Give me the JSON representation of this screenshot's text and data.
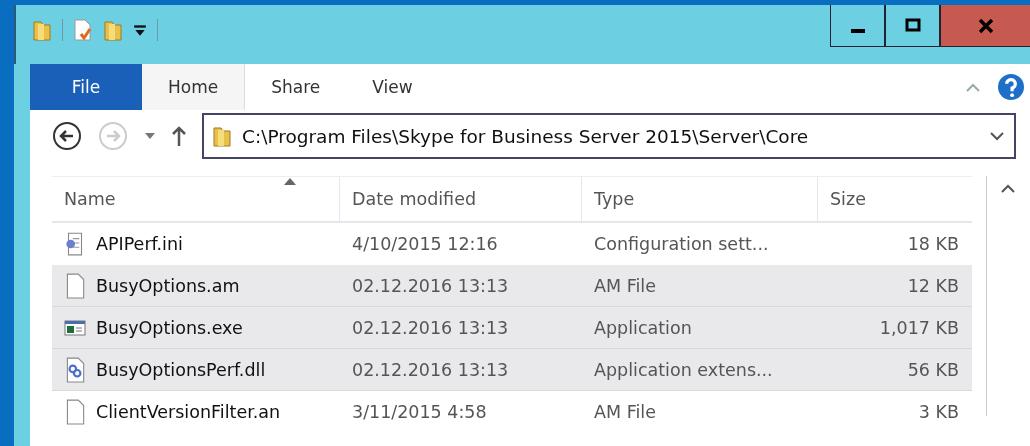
{
  "ribbon_tabs": [
    {
      "label": "File",
      "kind": "file",
      "selected": false
    },
    {
      "label": "Home",
      "kind": "tab",
      "selected": true
    },
    {
      "label": "Share",
      "kind": "tab",
      "selected": false
    },
    {
      "label": "View",
      "kind": "tab",
      "selected": false
    }
  ],
  "navigation": {
    "forward_disabled": true
  },
  "address": {
    "path": "C:\\Program Files\\Skype for Business Server 2015\\Server\\Core"
  },
  "columns": [
    {
      "label": "Name",
      "sorted": true
    },
    {
      "label": "Date modified",
      "sorted": false
    },
    {
      "label": "Type",
      "sorted": false
    },
    {
      "label": "Size",
      "sorted": false
    }
  ],
  "rows": [
    {
      "kind": "settings",
      "name": "APIPerf.ini",
      "date": "4/10/2015 12:16",
      "type": "Configuration sett...",
      "size": "18 KB",
      "selected": false
    },
    {
      "kind": "blank",
      "name": "BusyOptions.am",
      "date": "02.12.2016 13:13",
      "type": "AM File",
      "size": "12 KB",
      "selected": true
    },
    {
      "kind": "app",
      "name": "BusyOptions.exe",
      "date": "02.12.2016 13:13",
      "type": "Application",
      "size": "1,017 KB",
      "selected": true
    },
    {
      "kind": "dll",
      "name": "BusyOptionsPerf.dll",
      "date": "02.12.2016 13:13",
      "type": "Application extens...",
      "size": "56 KB",
      "selected": true
    },
    {
      "kind": "blank",
      "name": "ClientVersionFilter.an",
      "date": "3/11/2015 4:58",
      "type": "AM File",
      "size": "3 KB",
      "selected": false
    }
  ]
}
